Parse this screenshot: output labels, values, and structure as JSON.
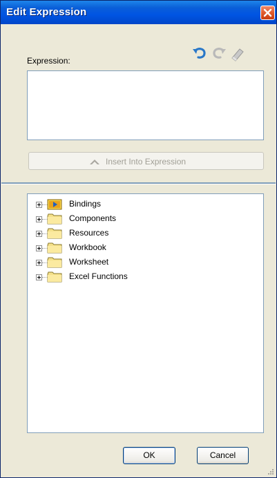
{
  "window": {
    "title": "Edit Expression"
  },
  "expression": {
    "label": "Expression:",
    "value": ""
  },
  "toolbar": {
    "icons": [
      "undo-icon",
      "redo-icon",
      "eraser-icon"
    ]
  },
  "insert_button": {
    "label": "Insert Into Expression",
    "enabled": false
  },
  "tree": {
    "items": [
      {
        "label": "Bindings",
        "icon": "bindings-folder-icon"
      },
      {
        "label": "Components",
        "icon": "folder-icon"
      },
      {
        "label": "Resources",
        "icon": "folder-icon"
      },
      {
        "label": "Workbook",
        "icon": "folder-icon"
      },
      {
        "label": "Worksheet",
        "icon": "folder-icon"
      },
      {
        "label": "Excel Functions",
        "icon": "folder-icon"
      }
    ]
  },
  "buttons": {
    "ok": "OK",
    "cancel": "Cancel"
  },
  "colors": {
    "titlebar": "#0054e3",
    "dialog_bg": "#ece9d8",
    "close": "#e05a2c"
  }
}
